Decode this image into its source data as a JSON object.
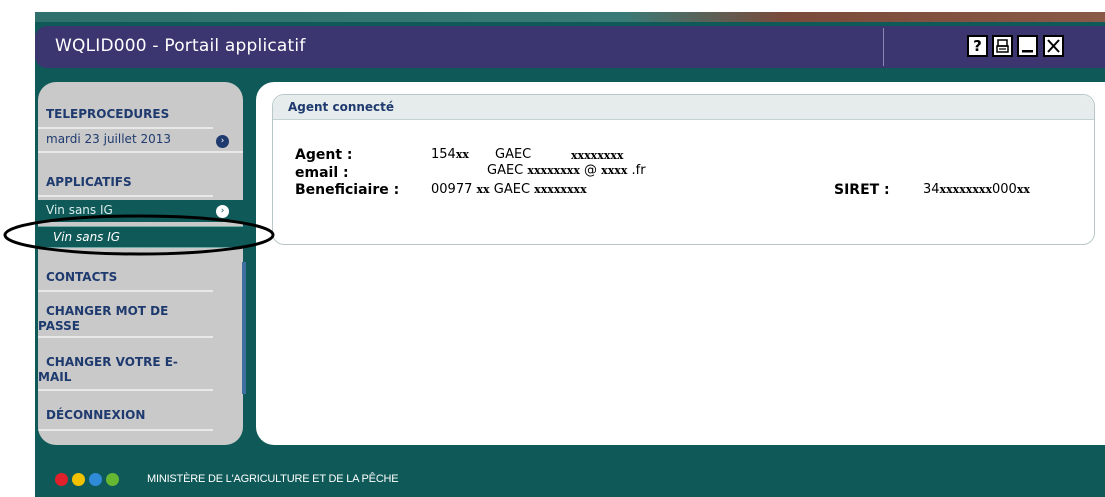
{
  "window": {
    "title": "WQLID000 - Portail applicatif",
    "buttons": {
      "help": "?",
      "print_icon": "print-icon",
      "minimize_icon": "minimize-icon",
      "close_icon": "close-icon"
    }
  },
  "sidebar": {
    "teleprocedures": "TELEPROCEDURES",
    "date": "mardi 23 juillet 2013",
    "applicatifs": "APPLICATIFS",
    "app_item": "Vin sans IG",
    "app_subitem": "Vin sans IG",
    "contacts": "CONTACTS",
    "change_password_1": "CHANGER MOT DE",
    "change_password_2": "PASSE",
    "change_email_1": "CHANGER VOTRE E-",
    "change_email_2": "MAIL",
    "logout": "DÉCONNEXION"
  },
  "panel": {
    "title": "Agent connecté",
    "agent_label": "Agent :",
    "agent_id_prefix": "154",
    "agent_id_mask": "xx",
    "agent_gaec": "GAEC",
    "agent_name_mask": "xxxxxxxx",
    "email_label": "email :",
    "email_gaec": "GAEC",
    "email_user_mask": "xxxxxxxx",
    "email_at": "@",
    "email_domain_mask": "xxxx",
    "email_tld": ".fr",
    "beneficiary_label": "Beneficiaire :",
    "beneficiary_prefix": "00977",
    "beneficiary_mask": "xx",
    "beneficiary_gaec": "GAEC",
    "beneficiary_name_mask": "xxxxxxxx",
    "siret_label": "SIRET :",
    "siret_prefix": "34",
    "siret_mask": "xxxxxxxx",
    "siret_mid": "000",
    "siret_suffix_mask": "xx"
  },
  "footer": {
    "ministry": "MINISTÈRE DE L'AGRICULTURE ET DE LA PÊCHE",
    "dots": [
      "#e0202a",
      "#f2c200",
      "#2f8ad8",
      "#66b832"
    ]
  }
}
